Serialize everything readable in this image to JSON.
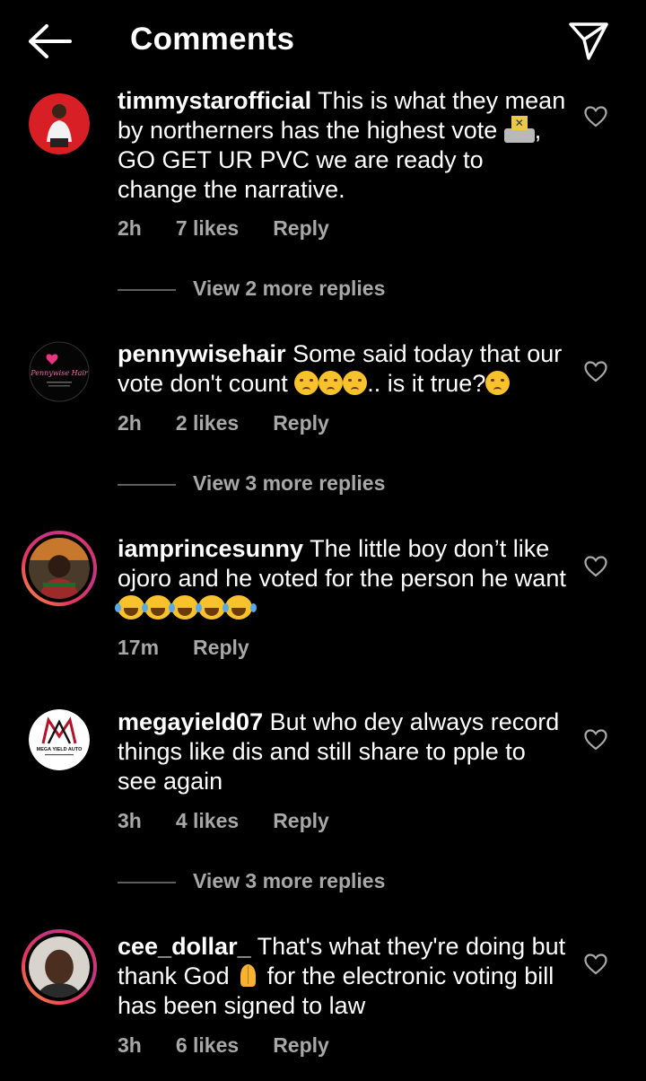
{
  "header": {
    "title": "Comments"
  },
  "comments": [
    {
      "username": "timmystarofficial",
      "text_a": " This is what they mean by northerners has the highest vote ",
      "text_b": ", GO GET UR PVC we are ready to change the narrative.",
      "time": "2h",
      "likes": "7 likes",
      "reply": "Reply",
      "view_replies": "View 2 more replies"
    },
    {
      "username": "pennywisehair",
      "text_a": " Some said today that our vote don't count ",
      "text_b": ".. is it true?",
      "time": "2h",
      "likes": "2 likes",
      "reply": "Reply",
      "view_replies": "View 3 more replies",
      "avatar_text": "Pennywise Hair"
    },
    {
      "username": "iamprincesunny",
      "text_a": " The little boy don’t like ojoro and he voted for the person he want ",
      "time": "17m",
      "reply": "Reply"
    },
    {
      "username": "megayield07",
      "text_a": " But who dey always record things like dis and still share to pple to see again",
      "time": "3h",
      "likes": "4 likes",
      "reply": "Reply",
      "view_replies": "View 3 more replies",
      "avatar_text": "MEGA YIELD AUTO"
    },
    {
      "username": "cee_dollar_",
      "text_a": " That's what they're doing but thank God ",
      "text_b": " for the electronic voting bill has been signed to law",
      "time": "3h",
      "likes": "6 likes",
      "reply": "Reply"
    }
  ],
  "icons": {
    "back": "arrow-left-icon",
    "send": "paper-plane-icon",
    "like": "heart-outline-icon"
  },
  "colors": {
    "background": "#000000",
    "text": "#ffffff",
    "meta": "#a8a8a8",
    "story_ring": "#e8365d"
  }
}
